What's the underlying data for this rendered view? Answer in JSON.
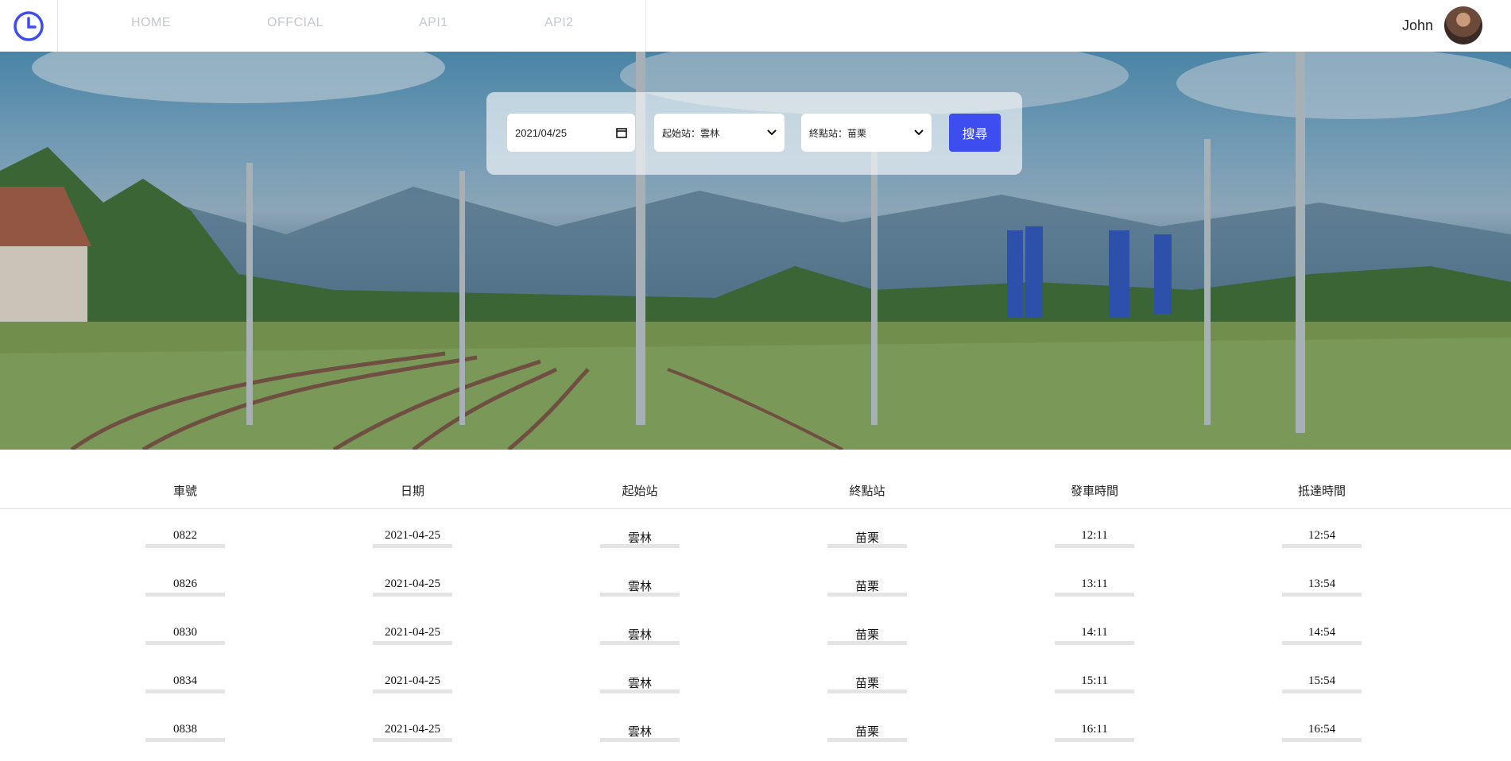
{
  "header": {
    "logo_icon": "clock-icon",
    "nav": [
      "HOME",
      "OFFCIAL",
      "API1",
      "API2"
    ],
    "user_name": "John"
  },
  "search": {
    "date": "2021/04/25",
    "from_label": "起始站：",
    "from_value": "雲林",
    "to_label": "終點站：",
    "to_value": "苗栗",
    "button": "搜尋",
    "accent_color": "#3d4df0"
  },
  "table": {
    "headers": [
      "車號",
      "日期",
      "起始站",
      "終點站",
      "發車時間",
      "抵達時間"
    ],
    "rows": [
      [
        "0822",
        "2021-04-25",
        "雲林",
        "苗栗",
        "12:11",
        "12:54"
      ],
      [
        "0826",
        "2021-04-25",
        "雲林",
        "苗栗",
        "13:11",
        "13:54"
      ],
      [
        "0830",
        "2021-04-25",
        "雲林",
        "苗栗",
        "14:11",
        "14:54"
      ],
      [
        "0834",
        "2021-04-25",
        "雲林",
        "苗栗",
        "15:11",
        "15:54"
      ],
      [
        "0838",
        "2021-04-25",
        "雲林",
        "苗栗",
        "16:11",
        "16:54"
      ]
    ]
  }
}
